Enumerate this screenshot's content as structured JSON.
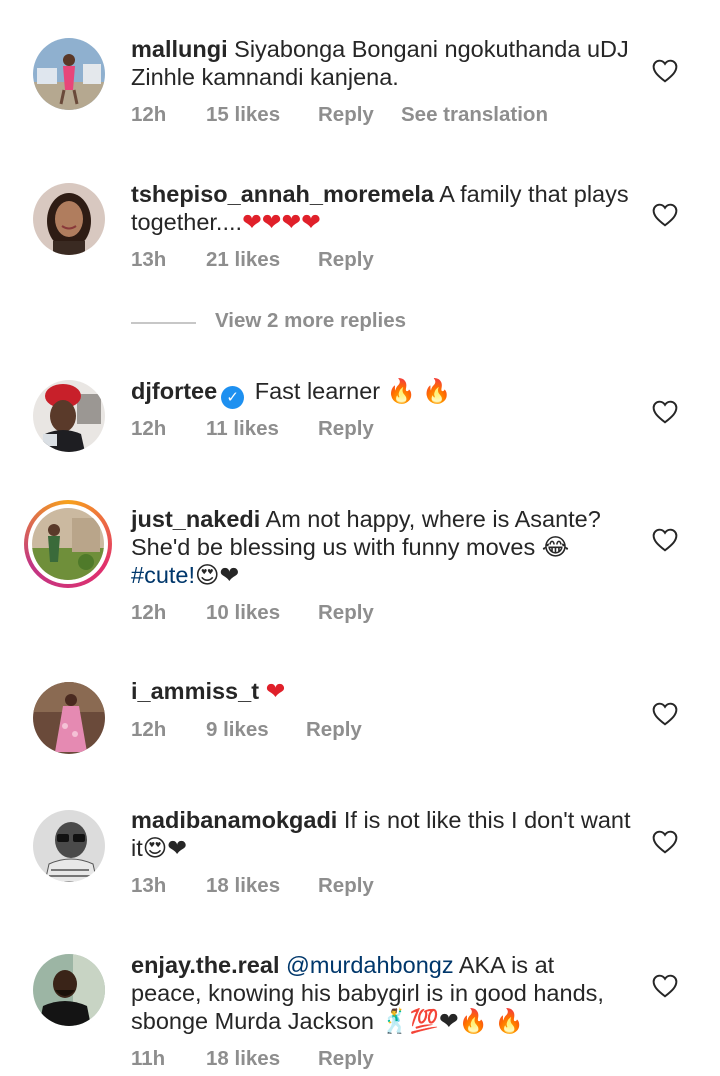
{
  "comments": [
    {
      "username": "mallungi",
      "text": "Siyabonga Bongani ngokuthanda uDJ Zinhle kamnandi kanjena.",
      "time": "12h",
      "likes": "15 likes",
      "reply": "Reply",
      "translation": "See translation"
    },
    {
      "username": "tshepiso_annah_moremela",
      "text": "A family that plays together....",
      "emojis": "❤❤❤❤",
      "time": "13h",
      "likes": "21 likes",
      "reply": "Reply"
    },
    {
      "username": "djfortee",
      "verified_mark": "✓",
      "text": "Fast learner",
      "emojis": "🔥 🔥",
      "time": "12h",
      "likes": "11 likes",
      "reply": "Reply"
    },
    {
      "username": "just_nakedi",
      "text": "Am not happy, where is Asante? She'd be blessing us with funny moves",
      "emoji_mid": "😂",
      "hashtag": "#cute!",
      "emojis": "😍❤",
      "time": "12h",
      "likes": "10 likes",
      "reply": "Reply"
    },
    {
      "username": "i_ammiss_t",
      "emojis": "❤",
      "time": "12h",
      "likes": "9 likes",
      "reply": "Reply"
    },
    {
      "username": "madibanamokgadi",
      "text": "If is not like this I don't want it",
      "emojis": "😍❤",
      "time": "13h",
      "likes": "18 likes",
      "reply": "Reply"
    },
    {
      "username": "enjay.the.real",
      "mention": "@murdahbongz",
      "text": "AKA is at peace, knowing his babygirl is in good hands, sbonge Murda Jackson",
      "emojis": "🕺💯❤🔥 🔥",
      "time": "11h",
      "likes": "18 likes",
      "reply": "Reply"
    }
  ],
  "view_replies": "View 2 more replies",
  "colors": {
    "text": "#262626",
    "meta": "#8e8e8e",
    "link": "#00376b",
    "verified": "#1e90f0",
    "heart_red": "#e0202a"
  },
  "icons": [
    "heart-outline-icon",
    "verified-badge-icon"
  ]
}
